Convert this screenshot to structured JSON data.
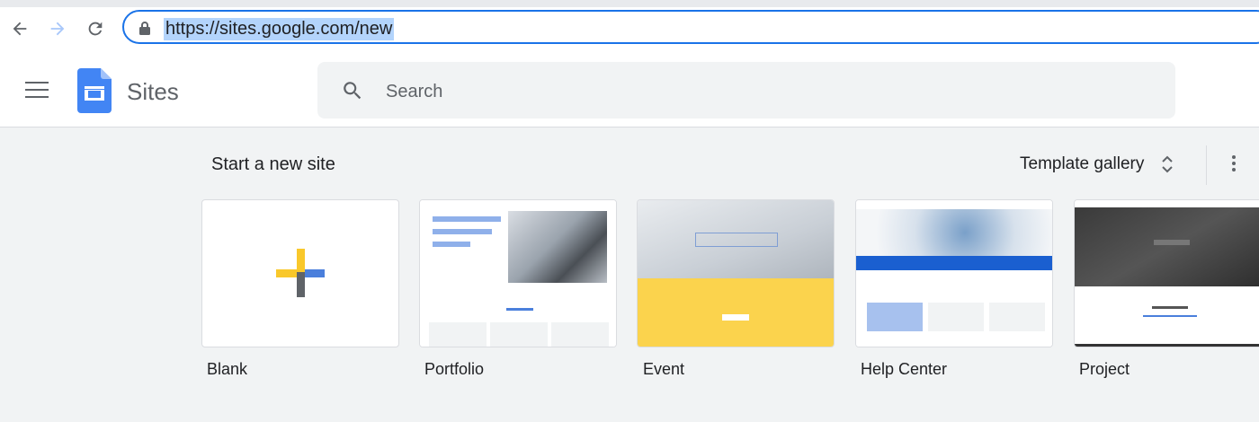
{
  "browser": {
    "url": "https://sites.google.com/new",
    "back_icon": "arrow-left-icon",
    "forward_icon": "arrow-right-icon",
    "reload_icon": "reload-icon",
    "lock_icon": "lock-icon"
  },
  "header": {
    "app_name": "Sites",
    "search_placeholder": "Search",
    "menu_icon": "hamburger-icon",
    "logo_icon": "google-sites-logo"
  },
  "main": {
    "section_title": "Start a new site",
    "template_gallery_label": "Template gallery",
    "templates": [
      {
        "label": "Blank"
      },
      {
        "label": "Portfolio"
      },
      {
        "label": "Event"
      },
      {
        "label": "Help Center"
      },
      {
        "label": "Project"
      }
    ]
  },
  "colors": {
    "accent": "#1a73e8",
    "sites_blue": "#4285f4",
    "event_yellow": "#fbd34d",
    "help_blue": "#1a5fd0",
    "project_dark": "#333333"
  }
}
